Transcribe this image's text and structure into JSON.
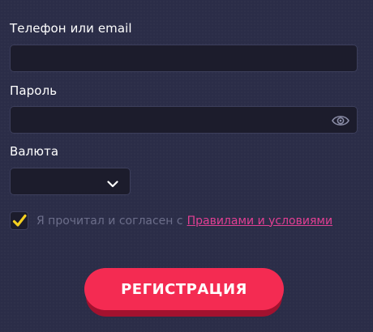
{
  "form": {
    "phone_label": "Телефон или email",
    "phone_value": "",
    "password_label": "Пароль",
    "password_value": "",
    "password_icon": "eye-icon",
    "currency_label": "Валюта",
    "currency_value": "",
    "currency_icon": "chevron-down-icon",
    "agree_checked": true,
    "agree_text": "Я прочитал и согласен с",
    "agree_link": "Правилами и условиями",
    "submit_label": "РЕГИСТРАЦИЯ"
  },
  "colors": {
    "background": "#2b2d48",
    "field_bg": "#1c1c2c",
    "accent_button": "#f42b52",
    "link": "#e23f93",
    "checkmark": "#f5d020"
  }
}
